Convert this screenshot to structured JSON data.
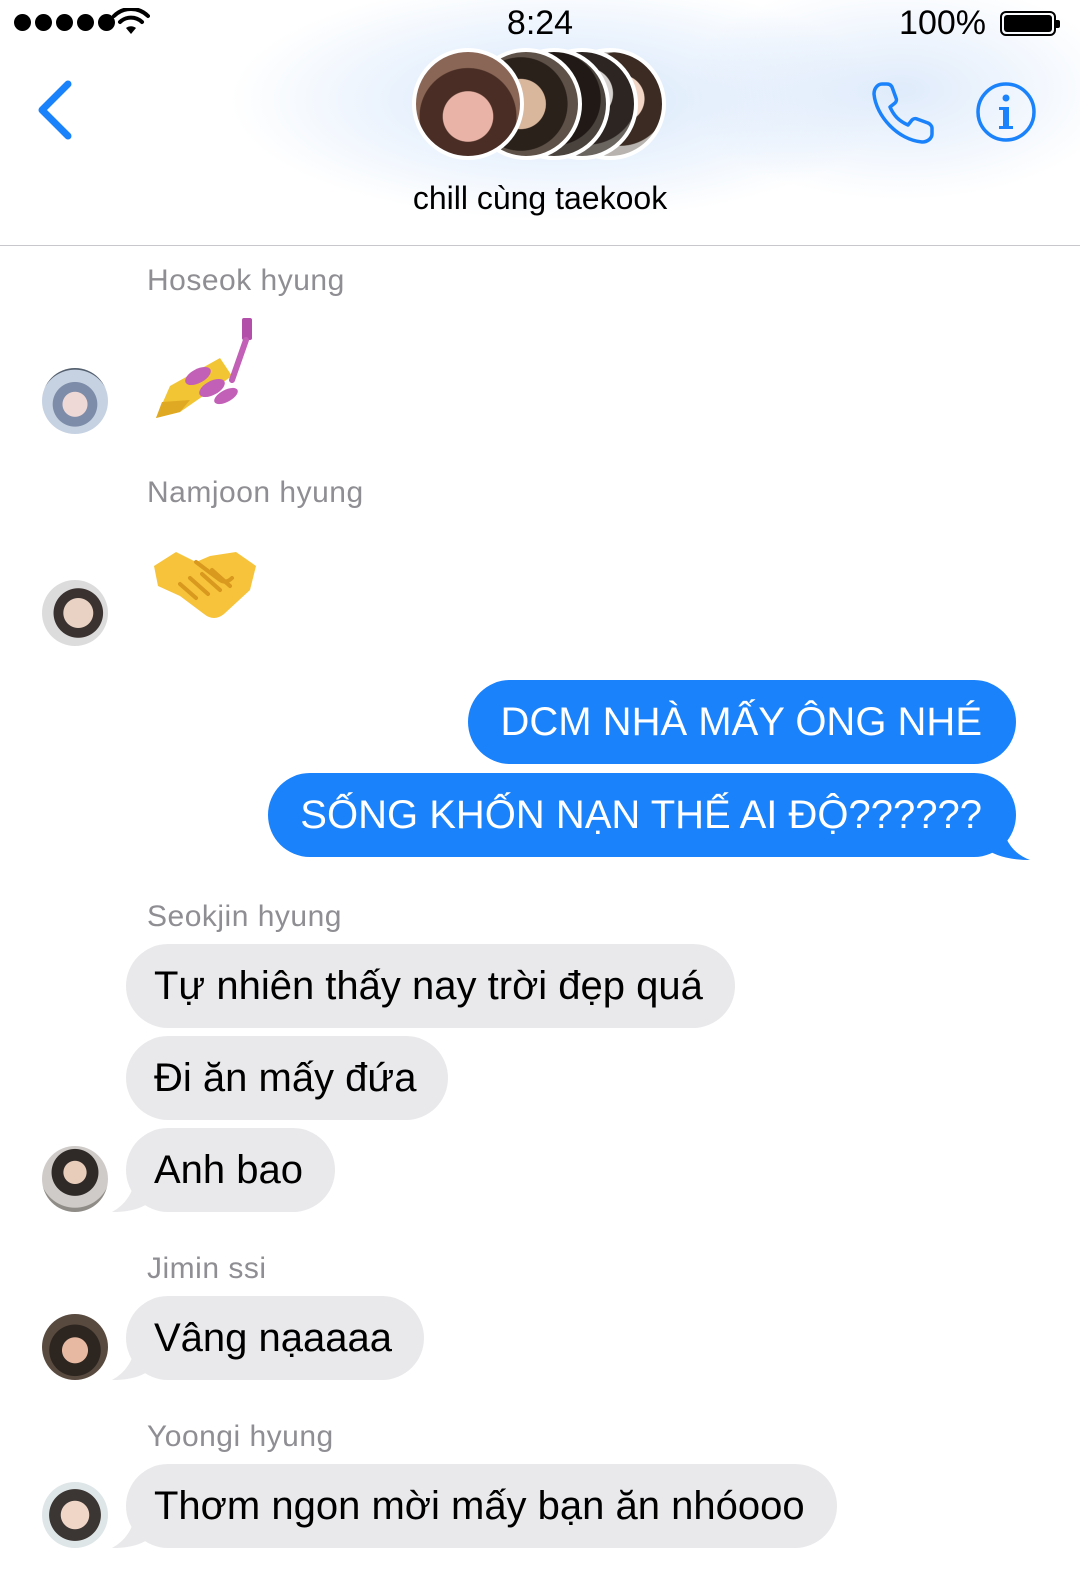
{
  "status_bar": {
    "time": "8:24",
    "battery": "100%"
  },
  "header": {
    "title": "chill cùng taekook"
  },
  "messages": [
    {
      "sender": "Hoseok hyung",
      "content_icon": "nail-polish-emoji"
    },
    {
      "sender": "Namjoon hyung",
      "content_icon": "handshake-emoji"
    },
    {
      "outgoing": [
        "DCM NHÀ MẤY ÔNG NHÉ",
        "SỐNG KHỐN NẠN THẾ AI ĐỘ??????"
      ]
    },
    {
      "sender": "Seokjin hyung",
      "lines": [
        "Tự nhiên thấy nay trời đẹp quá",
        "Đi ăn mấy đứa",
        "Anh bao"
      ]
    },
    {
      "sender": "Jimin ssi",
      "lines": [
        "Vâng nạaaaa"
      ]
    },
    {
      "sender": "Yoongi hyung",
      "lines": [
        "Thơm ngon mời mấy bạn ăn nhóooo"
      ]
    }
  ],
  "colors": {
    "accent": "#1a82fb",
    "incoming_bubble": "#e9e9eb",
    "sender_label": "#8e8e93"
  }
}
